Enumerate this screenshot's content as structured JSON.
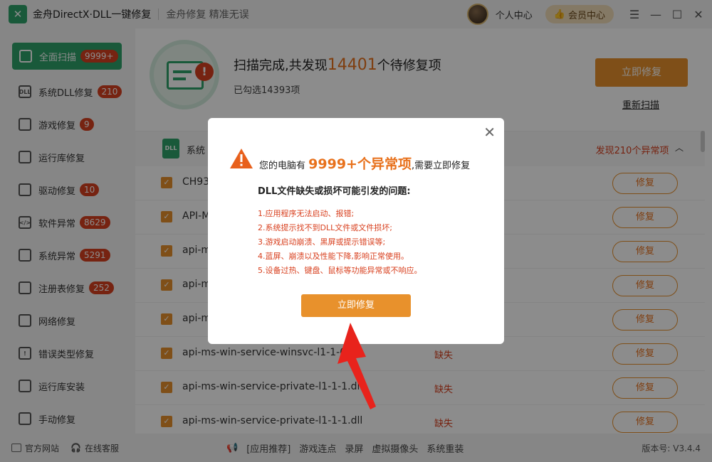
{
  "titlebar": {
    "app_title": "金舟DirectX·DLL一键修复",
    "subtitle": "金舟修复 精准无误",
    "personal_center": "个人中心",
    "vip_center": "会员中心"
  },
  "sidebar": {
    "items": [
      {
        "label": "全面扫描",
        "badge": "9999+",
        "icon": "scan-icon"
      },
      {
        "label": "系统DLL修复",
        "badge": "210",
        "icon": "dll-icon"
      },
      {
        "label": "游戏修复",
        "badge": "9",
        "icon": "gamepad-icon"
      },
      {
        "label": "运行库修复",
        "badge": "",
        "icon": "runtime-icon"
      },
      {
        "label": "驱动修复",
        "badge": "10",
        "icon": "driver-icon"
      },
      {
        "label": "软件异常",
        "badge": "8629",
        "icon": "software-icon"
      },
      {
        "label": "系统异常",
        "badge": "5291",
        "icon": "gear-icon"
      },
      {
        "label": "注册表修复",
        "badge": "252",
        "icon": "registry-icon"
      },
      {
        "label": "网络修复",
        "badge": "",
        "icon": "wifi-icon"
      },
      {
        "label": "错误类型修复",
        "badge": "",
        "icon": "warning-icon"
      },
      {
        "label": "运行库安装",
        "badge": "",
        "icon": "install-icon"
      },
      {
        "label": "手动修复",
        "badge": "",
        "icon": "wrench-icon"
      }
    ]
  },
  "scan": {
    "headline_prefix": "扫描完成,共发现",
    "count": "14401",
    "headline_suffix": "个待修复项",
    "selected": "已勾选14393项",
    "repair_now": "立即修复",
    "rescan": "重新扫描"
  },
  "section": {
    "title": "系统",
    "found": "发现210个异常项"
  },
  "rows": [
    {
      "name": "CH93",
      "status": "",
      "action": "修复"
    },
    {
      "name": "API-M",
      "status": "",
      "action": "修复"
    },
    {
      "name": "api-m",
      "status": "",
      "action": "修复"
    },
    {
      "name": "api-m",
      "status": "",
      "action": "修复"
    },
    {
      "name": "api-m",
      "status": "",
      "action": "修复"
    },
    {
      "name": "api-ms-win-service-winsvc-l1-1-0.dll",
      "status": "缺失",
      "action": "修复"
    },
    {
      "name": "api-ms-win-service-private-l1-1-1.dll",
      "status": "缺失",
      "action": "修复"
    },
    {
      "name": "api-ms-win-service-private-l1-1-1.dll",
      "status": "缺失",
      "action": "修复"
    }
  ],
  "footer": {
    "official_site": "官方网站",
    "online_service": "在线客服",
    "links": [
      "[应用推荐]",
      "游戏连点",
      "录屏",
      "虚拟摄像头",
      "系统重装"
    ],
    "version": "版本号: V3.4.4"
  },
  "modal": {
    "headline_prefix": "您的电脑有",
    "headline_count": "9999+个异常项",
    "headline_suffix": ",需要立即修复",
    "subtitle": "DLL文件缺失或损坏可能引发的问题:",
    "problems": [
      "1.应用程序无法启动、报错;",
      "2.系统提示找不到DLL文件或文件损坏;",
      "3.游戏启动崩溃、黑屏或提示错误等;",
      "4.蓝屏、崩溃以及性能下降,影响正常使用。",
      "5.设备过热、键盘、鼠标等功能异常或不响应。"
    ],
    "button": "立即修复"
  },
  "colors": {
    "brand_green": "#2ea36a",
    "accent_orange": "#e8912c",
    "alert_red": "#d8401f"
  }
}
